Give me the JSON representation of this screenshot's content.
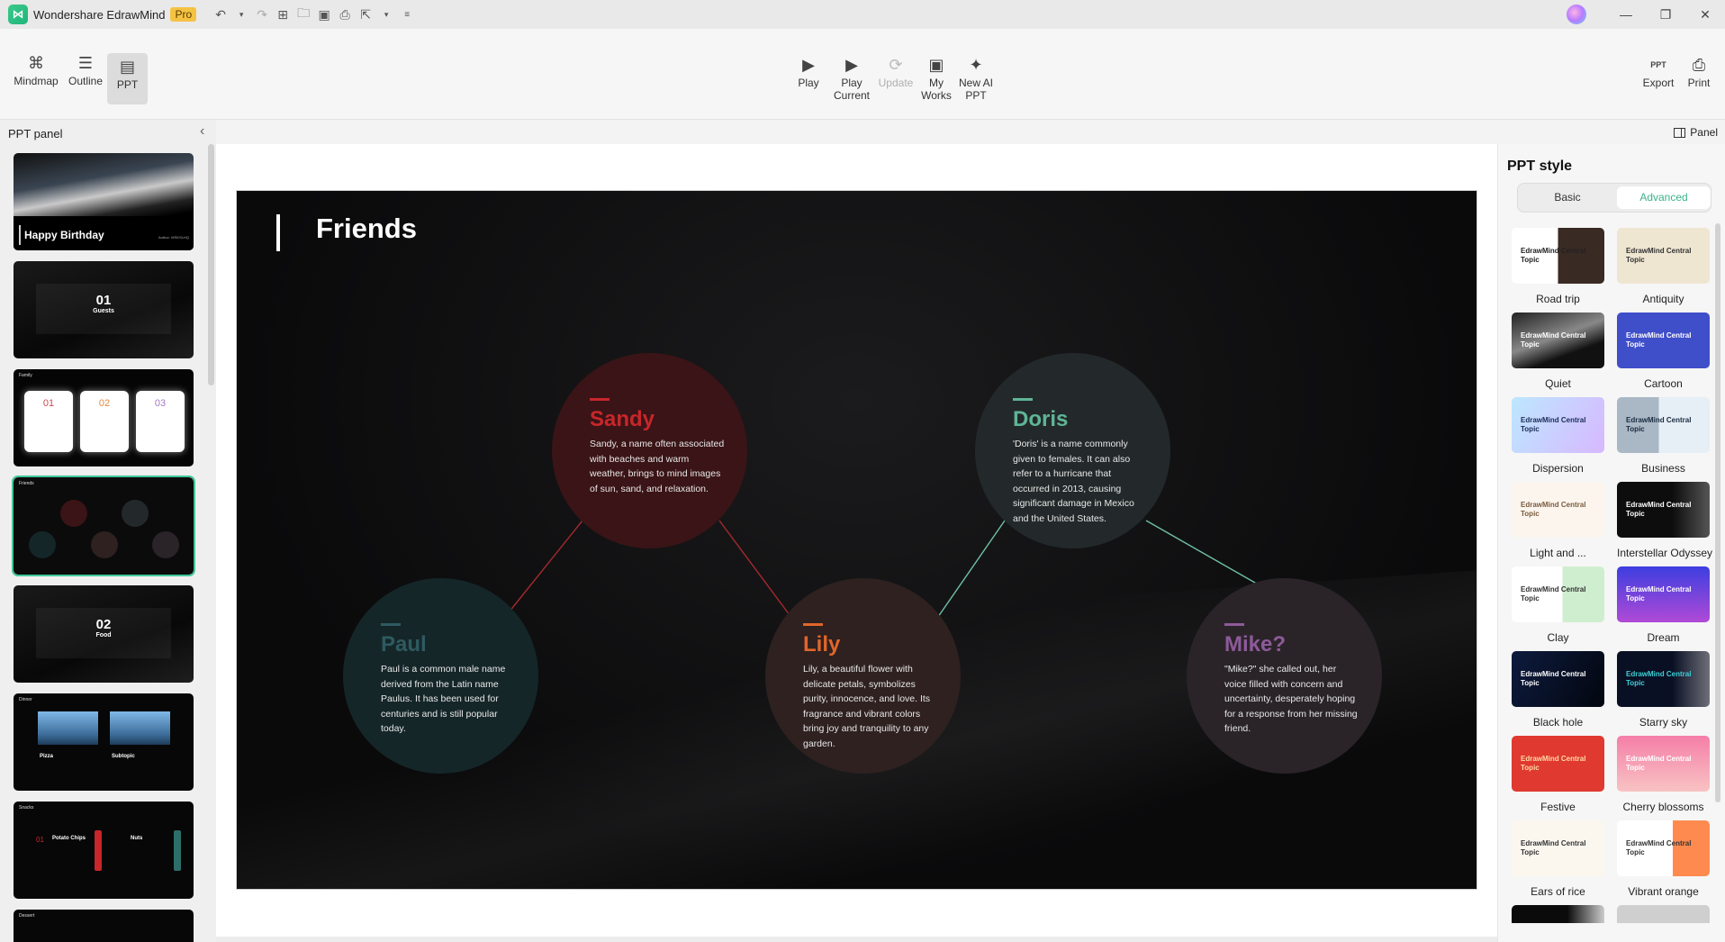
{
  "titlebar": {
    "app_name": "Wondershare EdrawMind",
    "badge": "Pro",
    "quick_access": [
      "undo-icon",
      "undo-dropdown",
      "redo-icon",
      "new-icon",
      "open-icon",
      "save-icon",
      "print-icon",
      "export-icon",
      "export-dropdown",
      "customize-icon"
    ],
    "window_controls": {
      "minimize": "—",
      "restore": "❐",
      "close": "✕"
    }
  },
  "toolbar": {
    "views": [
      {
        "label": "Mindmap",
        "icon": "⌘"
      },
      {
        "label": "Outline",
        "icon": "☰"
      },
      {
        "label": "PPT",
        "icon": "▤"
      }
    ],
    "ppt_actions": [
      {
        "label": "Play",
        "icon": "▶"
      },
      {
        "label": "Play\nCurrent",
        "icon": "▶"
      },
      {
        "label": "Update",
        "icon": "⟳"
      },
      {
        "label": "My\nWorks",
        "icon": "▣"
      },
      {
        "label": "New AI\nPPT",
        "icon": "✦"
      }
    ],
    "output": [
      {
        "label": "Export",
        "icon": "PPT"
      },
      {
        "label": "Print",
        "icon": "⎙"
      }
    ]
  },
  "left_panel": {
    "title": "PPT panel",
    "slides": [
      {
        "title": "Happy Birthday",
        "subtitle": "Author: WSKSLHQ",
        "type": "cover"
      },
      {
        "number": "01",
        "title": "Guests",
        "type": "section"
      },
      {
        "title": "Family",
        "cards": [
          "01",
          "02",
          "03"
        ],
        "type": "cards"
      },
      {
        "title": "Friends",
        "type": "circles",
        "selected": true
      },
      {
        "number": "02",
        "title": "Food",
        "type": "section"
      },
      {
        "title": "Dinner",
        "items": [
          "Pizza",
          "Subtopic"
        ],
        "type": "images"
      },
      {
        "title": "Snacks",
        "items": [
          "Potato Chips",
          "Nuts"
        ],
        "item_number": "01",
        "type": "list"
      },
      {
        "title": "Dessert",
        "type": "partial"
      }
    ]
  },
  "slide": {
    "title": "Friends",
    "nodes": [
      {
        "id": "sandy",
        "name": "Sandy",
        "desc": "Sandy, a name often associated with beaches and warm weather, brings to mind images of sun, sand, and relaxation.",
        "color": "#c7262b",
        "bg": "#3a1416"
      },
      {
        "id": "doris",
        "name": "Doris",
        "desc": "'Doris' is a name commonly given to females. It can also refer to a hurricane that occurred in 2013, causing significant damage in Mexico and the United States.",
        "color": "#5fb596",
        "bg": "#23292a"
      },
      {
        "id": "paul",
        "name": "Paul",
        "desc": "Paul is a common male name derived from the Latin name Paulus. It has been used for centuries and is still popular today.",
        "color": "#2e5a60",
        "bg": "#152629"
      },
      {
        "id": "lily",
        "name": "Lily",
        "desc": "Lily, a beautiful flower with delicate petals, symbolizes purity, innocence, and love. Its fragrance and vibrant colors bring joy and tranquility to any garden.",
        "color": "#e0662a",
        "bg": "#2e2120"
      },
      {
        "id": "mike",
        "name": "Mike?",
        "desc": "\"Mike?\" she called out, her voice filled with concern and uncertainty, desperately hoping for a response from her missing friend.",
        "color": "#8e5a9a",
        "bg": "#2a2429"
      }
    ]
  },
  "right_panel": {
    "panel_toggle": "Panel",
    "title": "PPT style",
    "tabs": [
      {
        "label": "Basic",
        "active": false
      },
      {
        "label": "Advanced",
        "active": true
      }
    ],
    "thumb_text": "EdrawMind Central Topic",
    "styles": [
      {
        "label": "Road trip",
        "bg": "linear-gradient(90deg,#fff 50%,#3a2a24 50%)",
        "fg": "#222"
      },
      {
        "label": "Antiquity",
        "bg": "#efe6d2",
        "fg": "#333"
      },
      {
        "label": "Quiet",
        "bg": "linear-gradient(160deg,#222,#888 45%,#111 70%)",
        "fg": "#fff"
      },
      {
        "label": "Cartoon",
        "bg": "#3f4ec9",
        "fg": "#fff"
      },
      {
        "label": "Dispersion",
        "bg": "linear-gradient(120deg,#bde7ff,#d7b8ff)",
        "fg": "#1a2b55"
      },
      {
        "label": "Business",
        "bg": "linear-gradient(90deg,#aab8c6 45%,#e6eef6 45%)",
        "fg": "#1a2b40"
      },
      {
        "label": "Light and ...",
        "bg": "#fbf5ee",
        "fg": "#7a5b3d"
      },
      {
        "label": "Interstellar Odyssey",
        "bg": "linear-gradient(90deg,#0d0d0d 60%,#555 100%)",
        "fg": "#fff"
      },
      {
        "label": "Clay",
        "bg": "linear-gradient(90deg,#fff 55%,#cfeecf 55%)",
        "fg": "#333"
      },
      {
        "label": "Dream",
        "bg": "linear-gradient(180deg,#3d3ee0,#b04ad6)",
        "fg": "#fff"
      },
      {
        "label": "Black hole",
        "bg": "linear-gradient(120deg,#0d1b3e,#03060f)",
        "fg": "#fff"
      },
      {
        "label": "Starry sky",
        "bg": "linear-gradient(90deg,#0a1024 60%,#6f6f7a 100%)",
        "fg": "#3fd0d6"
      },
      {
        "label": "Festive",
        "bg": "#e0392f",
        "fg": "#ffd9a8"
      },
      {
        "label": "Cherry blossoms",
        "bg": "linear-gradient(180deg,#f57ea8,#f8c3c3)",
        "fg": "#fff"
      },
      {
        "label": "Ears of rice",
        "bg": "#fbf7ef",
        "fg": "#333"
      },
      {
        "label": "Vibrant orange",
        "bg": "linear-gradient(90deg,#fff 60%,#ff8a4f 60%)",
        "fg": "#333"
      },
      {
        "label": "",
        "bg": "linear-gradient(90deg,#0b0b0b 60%,#ccc)",
        "fg": "#fff"
      },
      {
        "label": "",
        "bg": "#cfcfcf",
        "fg": "#333"
      }
    ]
  }
}
